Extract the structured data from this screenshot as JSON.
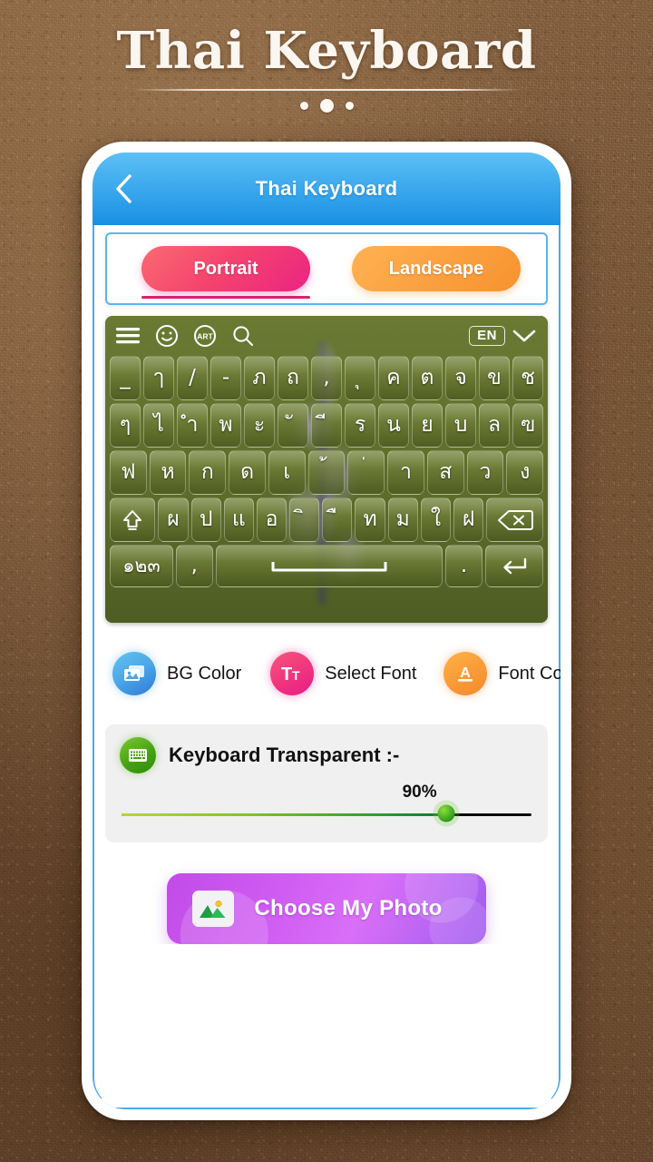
{
  "banner": {
    "title": "Thai Keyboard",
    "dots": 3
  },
  "phone": {
    "header": {
      "title": "Thai Keyboard",
      "back_icon": "chevron-left-icon"
    },
    "mode_tabs": [
      {
        "label": "Portrait",
        "selected": true,
        "color": "#ec2382"
      },
      {
        "label": "Landscape",
        "selected": false,
        "color": "#f8922f"
      }
    ],
    "keyboard": {
      "toolbar": {
        "icons": [
          "menu-icon",
          "emoji-icon",
          "art-icon",
          "search-icon"
        ],
        "art_label": "ART",
        "language_badge": "EN",
        "chevron_icon": "chevron-down-icon"
      },
      "rows": [
        {
          "keys": [
            "_",
            "ๅ",
            "/",
            "-",
            "ภ",
            "ถ",
            ",",
            "ุ",
            "ค",
            "ต",
            "จ",
            "ข",
            "ช"
          ]
        },
        {
          "keys": [
            "ๆ",
            "ไ",
            "ำ",
            "พ",
            "ะ",
            "ั",
            "ี",
            "ร",
            "น",
            "ย",
            "บ",
            "ล",
            "ฃ"
          ]
        },
        {
          "keys": [
            "ฟ",
            "ห",
            "ก",
            "ด",
            "เ",
            "้",
            "่",
            "า",
            "ส",
            "ว",
            "ง"
          ]
        },
        {
          "keys": [
            "⇧",
            "ผ",
            "ป",
            "แ",
            "อ",
            "ิ",
            "ื",
            "ท",
            "ม",
            "ใ",
            "ฝ",
            "⌫"
          ]
        },
        {
          "keys": [
            "๑๒๓",
            ",",
            " ",
            ".",
            "↵"
          ]
        }
      ]
    },
    "options": [
      {
        "label": "BG Color",
        "icon": "image-icon",
        "color": "#4aa6e8"
      },
      {
        "label": "Select Font",
        "icon": "text-size-icon",
        "color": "#f23a7e"
      },
      {
        "label": "Font Color",
        "icon": "font-color-icon",
        "color": "#fb9c38"
      }
    ],
    "transparency": {
      "label": "Keyboard Transparent :-",
      "icon": "keyboard-icon",
      "value": "90%",
      "percent": 90
    },
    "choose_photo": {
      "label": "Choose My Photo",
      "icon": "photo-icon"
    }
  }
}
